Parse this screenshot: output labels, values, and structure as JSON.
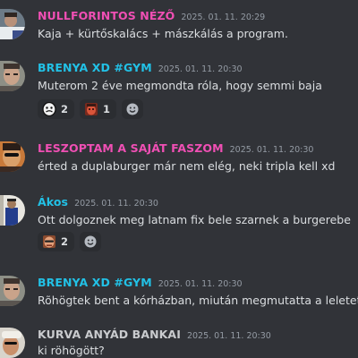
{
  "colors": {
    "background": "#313338",
    "pink": "#f04fb4",
    "cyan": "#22c1e6",
    "gray_name": "#c9cbce",
    "timestamp": "#949ba4",
    "text": "#dbdee1"
  },
  "messages": [
    {
      "author": "NULLFORINTOS NÉZŐ",
      "author_color": "pink",
      "timestamp": "2025. 01. 11. 20:29",
      "text": "Kaja + kürtőskalács + mászkálás a program.",
      "avatar_icon": "avatar-person-photo"
    },
    {
      "author": "BRENYA XD #GYM",
      "author_color": "cyan",
      "timestamp": "2025. 01. 11. 20:30",
      "text": "Muterom 2 éve megmondta róla, hogy semmi baja",
      "avatar_icon": "avatar-person-photo",
      "reactions": [
        {
          "emoji": "custom-face-emoji",
          "count": "2"
        },
        {
          "emoji": "custom-red-face-emoji",
          "count": "1"
        }
      ]
    },
    {
      "author": "LESZOPTAM A SAJÁT FASZOM",
      "author_color": "pink",
      "timestamp": "2025. 01. 11. 20:30",
      "text": "érted a duplaburger már nem elég, neki tripla kell xd",
      "avatar_icon": "avatar-person-photo"
    },
    {
      "author": "Ákos",
      "author_color": "cyan",
      "timestamp": "2025. 01. 11. 20:30",
      "text": "Ott dolgoznek meg latnam fix bele szarnek a burgerebe",
      "avatar_icon": "avatar-person-photo",
      "reactions": [
        {
          "emoji": "custom-face-emoji",
          "count": "2"
        }
      ]
    },
    {
      "author": "BRENYA XD #GYM",
      "author_color": "cyan",
      "timestamp": "2025. 01. 11. 20:30",
      "text": "Rõhögtek bent a kórházban, miután megmutatta a leletet",
      "avatar_icon": "avatar-person-photo"
    },
    {
      "author": "KURVA ANYÁD BANKAI",
      "author_color": "gray_name",
      "timestamp": "2025. 01. 11. 20:30",
      "text": "ki röhögött?",
      "avatar_icon": "avatar-person-photo"
    }
  ]
}
